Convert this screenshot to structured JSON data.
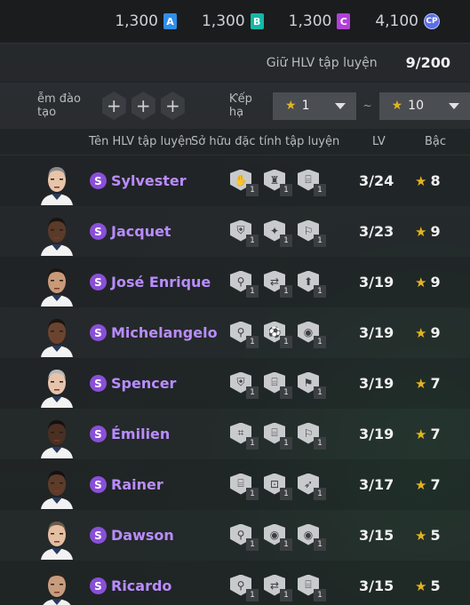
{
  "currencies": [
    {
      "value": "1,300",
      "badge": "A",
      "color": "#2f8fe8"
    },
    {
      "value": "1,300",
      "badge": "B",
      "color": "#14b8a6"
    },
    {
      "value": "1,300",
      "badge": "C",
      "color": "#b23fd9"
    },
    {
      "value": "4,100",
      "badge": "CP",
      "color": "#5b6ee8"
    }
  ],
  "capacity": {
    "label": "Giữ HLV tập luyện",
    "value": "9/200"
  },
  "filters": {
    "training_label": "ễm đào tạo",
    "slot_symbol": "+",
    "rank_label": "Ƙếp hạ",
    "rank_from": "1",
    "rank_to": "10",
    "separator": "~"
  },
  "columns": {
    "name": "Tên HLV tập luyện",
    "traits": "Sở hữu đặc tính tập luyện",
    "lv": "LV",
    "grade": "Bậc"
  },
  "coaches": [
    {
      "name": "Sylvester",
      "lv": "3/24",
      "grade": "8",
      "traits": [
        "1",
        "1",
        "1"
      ],
      "skin": "#e8c4a8",
      "hair": "#8a8a8a"
    },
    {
      "name": "Jacquet",
      "lv": "3/23",
      "grade": "9",
      "traits": [
        "1",
        "1",
        "1"
      ],
      "skin": "#5a3a28",
      "hair": "#1a1412"
    },
    {
      "name": "José Enrique",
      "lv": "3/19",
      "grade": "9",
      "traits": [
        "1",
        "1",
        "1"
      ],
      "skin": "#c99a78",
      "hair": "#1e1712"
    },
    {
      "name": "Michelangelo",
      "lv": "3/19",
      "grade": "9",
      "traits": [
        "1",
        "1",
        "1"
      ],
      "skin": "#6b4430",
      "hair": "#1a1412"
    },
    {
      "name": "Spencer",
      "lv": "3/19",
      "grade": "7",
      "traits": [
        "1",
        "1",
        "1"
      ],
      "skin": "#e6c4ab",
      "hair": "#b8b8b8"
    },
    {
      "name": "Émilien",
      "lv": "3/19",
      "grade": "7",
      "traits": [
        "1",
        "1",
        "1"
      ],
      "skin": "#4a3022",
      "hair": "#151010"
    },
    {
      "name": "Rainer",
      "lv": "3/17",
      "grade": "7",
      "traits": [
        "1",
        "1",
        "1"
      ],
      "skin": "#5e3c2a",
      "hair": "#151010"
    },
    {
      "name": "Dawson",
      "lv": "3/15",
      "grade": "5",
      "traits": [
        "1",
        "1",
        "1"
      ],
      "skin": "#e4bfa2",
      "hair": "#6a5a4a"
    },
    {
      "name": "Ricardo",
      "lv": "3/15",
      "grade": "5",
      "traits": [
        "1",
        "1",
        "1"
      ],
      "skin": "#c89c7c",
      "hair": "#2a2420"
    }
  ],
  "trait_icons": [
    [
      "hand-icon",
      "tower-icon",
      "goal-icon"
    ],
    [
      "shield-figure-icon",
      "player-icon",
      "runner-icon"
    ],
    [
      "arms-up-icon",
      "swap-icon",
      "arrow-up-icon"
    ],
    [
      "arms-up-icon",
      "dribble-icon",
      "ball-icon"
    ],
    [
      "shield-figure-icon",
      "goal-icon",
      "ball-kick-icon"
    ],
    [
      "goal-net-icon",
      "goal-icon",
      "runner-icon"
    ],
    [
      "goal-icon",
      "lock-icon",
      "shot-icon"
    ],
    [
      "arms-up-icon",
      "ball-icon",
      "ball-icon"
    ],
    [
      "arms-up-icon",
      "swap-icon",
      "goal-icon"
    ]
  ],
  "colors": {
    "accent_name": "#b98cff",
    "star": "#e2b520",
    "s_badge": "#8a4fd8"
  }
}
